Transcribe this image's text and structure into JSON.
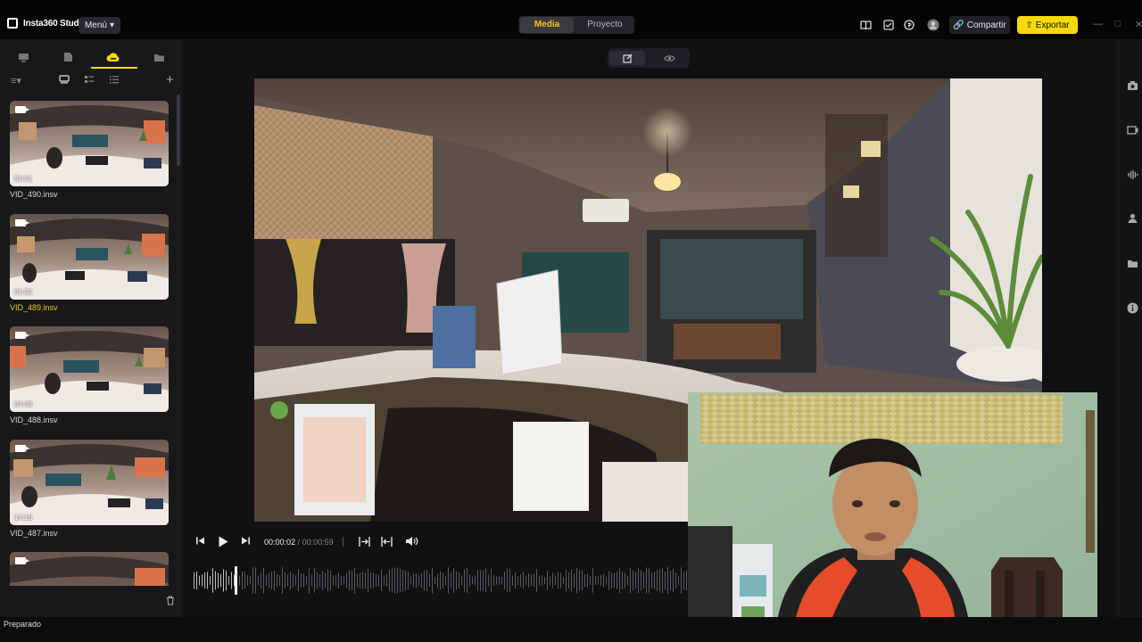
{
  "app": {
    "name": "Insta360 Studio",
    "menu_label": "Menú"
  },
  "tabs": {
    "media": "Media",
    "project": "Proyecto"
  },
  "header_actions": {
    "share_label": "Compartir",
    "export_label": "Exportar"
  },
  "sidebar": {
    "clips": [
      {
        "name": "VID_490.insv",
        "duration": "02:01",
        "selected": false
      },
      {
        "name": "VID_489.insv",
        "duration": "01:02",
        "selected": true
      },
      {
        "name": "VID_488.insv",
        "duration": "04:48",
        "selected": false
      },
      {
        "name": "VID_487.insv",
        "duration": "14:16",
        "selected": false
      },
      {
        "name": "",
        "duration": "",
        "selected": false
      }
    ]
  },
  "player": {
    "current_time": "00:00:02",
    "separator": " / ",
    "total_time": "00:00:59"
  },
  "status": {
    "text": "Preparado"
  },
  "colors": {
    "accent": "#f5d90a",
    "selected_text": "#f5c518",
    "background": "#111113",
    "panel": "#18181b"
  },
  "icons": {
    "top": [
      "book-icon",
      "checklist-icon",
      "coin-icon",
      "avatar-icon"
    ],
    "right_panel": [
      "camera-icon",
      "video-edit-icon",
      "audio-icon",
      "user-upload-icon",
      "folder-icon",
      "info-icon"
    ]
  }
}
